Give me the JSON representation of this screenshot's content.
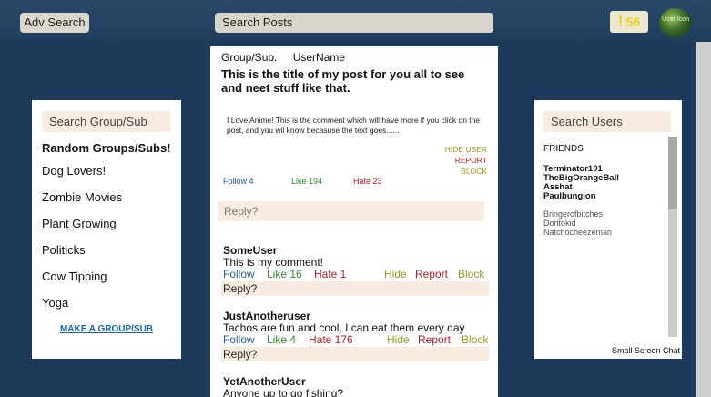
{
  "topbar": {
    "adv_search_label": "Adv Search",
    "search_placeholder": "Search Posts",
    "notification_icon": "!",
    "notification_count": "56",
    "avatar_text": "User Icon"
  },
  "left_panel": {
    "search_placeholder": "Search Group/Sub",
    "heading": "Random Groups/Subs!",
    "groups": [
      "Dog Lovers!",
      "Zombie Movies",
      "Plant Growing",
      "Politicks",
      "Cow Tipping",
      "Yoga"
    ],
    "make_group_link": "MAKE A GROUP/SUB"
  },
  "post": {
    "group": "Group/Sub.",
    "username": "UserName",
    "title": "This is the title of my post for you all to see and neet stuff like that.",
    "body": "I Love Anime! This is the comment which will have more if you click on the post, and you wil know becasuse the text goes......",
    "hide_user": "HIDE USER",
    "report": "REPORT",
    "block": "BLOCK",
    "follow": "Follow 4",
    "like": "Like 194",
    "hate": "Hate 23",
    "reply_placeholder": "Reply?"
  },
  "comments": [
    {
      "user": "SomeUser",
      "text": "This is my comment!",
      "follow": "Follow",
      "like": "Like 16",
      "hate": "Hate 1",
      "hide": "Hide",
      "report": "Report",
      "block": "Block",
      "reply": "Reply?"
    },
    {
      "user": "JustAnotheruser",
      "text": "Tachos are fun and cool, I can eat them every day",
      "follow": "Follow",
      "like": "Like 4",
      "hate": "Hate 176",
      "hide": "Hide",
      "report": "Report",
      "block": "Block",
      "reply": "Reply?"
    },
    {
      "user": "YetAnotherUser",
      "text": "Anyone up to go fishing?"
    }
  ],
  "right_panel": {
    "search_placeholder": "Search Users",
    "friends_label": "FRIENDS",
    "online_friends": [
      "Terminator101",
      "TheBigOrangeBall",
      "Asshat",
      "Paulbungion"
    ],
    "offline_friends": [
      "Bringerofbitches",
      "Doritokid",
      "Natchocheezeman"
    ],
    "small_chat_label": "Small Screen Chat"
  },
  "colors": {
    "background": "#1d3a5a",
    "input_fill": "#f8ece0",
    "follow": "#1f5c96",
    "like": "#2e8a2e",
    "hate": "#b81c1c",
    "hide": "#9c9a1a"
  }
}
